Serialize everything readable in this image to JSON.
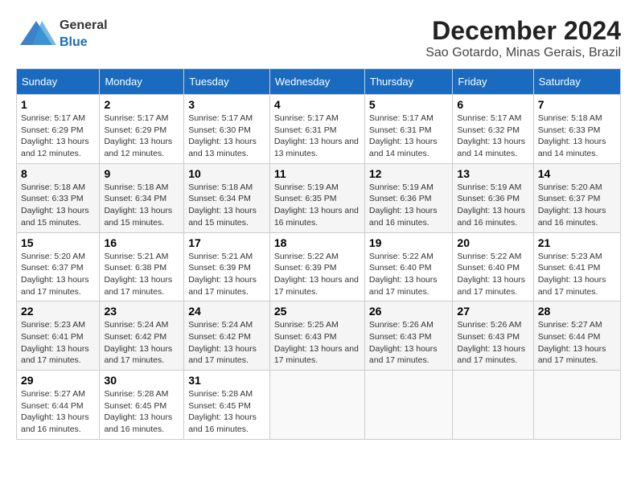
{
  "logo": {
    "text_general": "General",
    "text_blue": "Blue"
  },
  "title": "December 2024",
  "subtitle": "Sao Gotardo, Minas Gerais, Brazil",
  "days_of_week": [
    "Sunday",
    "Monday",
    "Tuesday",
    "Wednesday",
    "Thursday",
    "Friday",
    "Saturday"
  ],
  "weeks": [
    [
      {
        "day": "1",
        "sunrise": "5:17 AM",
        "sunset": "6:29 PM",
        "daylight": "13 hours and 12 minutes."
      },
      {
        "day": "2",
        "sunrise": "5:17 AM",
        "sunset": "6:29 PM",
        "daylight": "13 hours and 12 minutes."
      },
      {
        "day": "3",
        "sunrise": "5:17 AM",
        "sunset": "6:30 PM",
        "daylight": "13 hours and 13 minutes."
      },
      {
        "day": "4",
        "sunrise": "5:17 AM",
        "sunset": "6:31 PM",
        "daylight": "13 hours and 13 minutes."
      },
      {
        "day": "5",
        "sunrise": "5:17 AM",
        "sunset": "6:31 PM",
        "daylight": "13 hours and 14 minutes."
      },
      {
        "day": "6",
        "sunrise": "5:17 AM",
        "sunset": "6:32 PM",
        "daylight": "13 hours and 14 minutes."
      },
      {
        "day": "7",
        "sunrise": "5:18 AM",
        "sunset": "6:33 PM",
        "daylight": "13 hours and 14 minutes."
      }
    ],
    [
      {
        "day": "8",
        "sunrise": "5:18 AM",
        "sunset": "6:33 PM",
        "daylight": "13 hours and 15 minutes."
      },
      {
        "day": "9",
        "sunrise": "5:18 AM",
        "sunset": "6:34 PM",
        "daylight": "13 hours and 15 minutes."
      },
      {
        "day": "10",
        "sunrise": "5:18 AM",
        "sunset": "6:34 PM",
        "daylight": "13 hours and 15 minutes."
      },
      {
        "day": "11",
        "sunrise": "5:19 AM",
        "sunset": "6:35 PM",
        "daylight": "13 hours and 16 minutes."
      },
      {
        "day": "12",
        "sunrise": "5:19 AM",
        "sunset": "6:36 PM",
        "daylight": "13 hours and 16 minutes."
      },
      {
        "day": "13",
        "sunrise": "5:19 AM",
        "sunset": "6:36 PM",
        "daylight": "13 hours and 16 minutes."
      },
      {
        "day": "14",
        "sunrise": "5:20 AM",
        "sunset": "6:37 PM",
        "daylight": "13 hours and 16 minutes."
      }
    ],
    [
      {
        "day": "15",
        "sunrise": "5:20 AM",
        "sunset": "6:37 PM",
        "daylight": "13 hours and 17 minutes."
      },
      {
        "day": "16",
        "sunrise": "5:21 AM",
        "sunset": "6:38 PM",
        "daylight": "13 hours and 17 minutes."
      },
      {
        "day": "17",
        "sunrise": "5:21 AM",
        "sunset": "6:39 PM",
        "daylight": "13 hours and 17 minutes."
      },
      {
        "day": "18",
        "sunrise": "5:22 AM",
        "sunset": "6:39 PM",
        "daylight": "13 hours and 17 minutes."
      },
      {
        "day": "19",
        "sunrise": "5:22 AM",
        "sunset": "6:40 PM",
        "daylight": "13 hours and 17 minutes."
      },
      {
        "day": "20",
        "sunrise": "5:22 AM",
        "sunset": "6:40 PM",
        "daylight": "13 hours and 17 minutes."
      },
      {
        "day": "21",
        "sunrise": "5:23 AM",
        "sunset": "6:41 PM",
        "daylight": "13 hours and 17 minutes."
      }
    ],
    [
      {
        "day": "22",
        "sunrise": "5:23 AM",
        "sunset": "6:41 PM",
        "daylight": "13 hours and 17 minutes."
      },
      {
        "day": "23",
        "sunrise": "5:24 AM",
        "sunset": "6:42 PM",
        "daylight": "13 hours and 17 minutes."
      },
      {
        "day": "24",
        "sunrise": "5:24 AM",
        "sunset": "6:42 PM",
        "daylight": "13 hours and 17 minutes."
      },
      {
        "day": "25",
        "sunrise": "5:25 AM",
        "sunset": "6:43 PM",
        "daylight": "13 hours and 17 minutes."
      },
      {
        "day": "26",
        "sunrise": "5:26 AM",
        "sunset": "6:43 PM",
        "daylight": "13 hours and 17 minutes."
      },
      {
        "day": "27",
        "sunrise": "5:26 AM",
        "sunset": "6:43 PM",
        "daylight": "13 hours and 17 minutes."
      },
      {
        "day": "28",
        "sunrise": "5:27 AM",
        "sunset": "6:44 PM",
        "daylight": "13 hours and 17 minutes."
      }
    ],
    [
      {
        "day": "29",
        "sunrise": "5:27 AM",
        "sunset": "6:44 PM",
        "daylight": "13 hours and 16 minutes."
      },
      {
        "day": "30",
        "sunrise": "5:28 AM",
        "sunset": "6:45 PM",
        "daylight": "13 hours and 16 minutes."
      },
      {
        "day": "31",
        "sunrise": "5:28 AM",
        "sunset": "6:45 PM",
        "daylight": "13 hours and 16 minutes."
      },
      null,
      null,
      null,
      null
    ]
  ],
  "labels": {
    "sunrise": "Sunrise:",
    "sunset": "Sunset:",
    "daylight": "Daylight:"
  }
}
